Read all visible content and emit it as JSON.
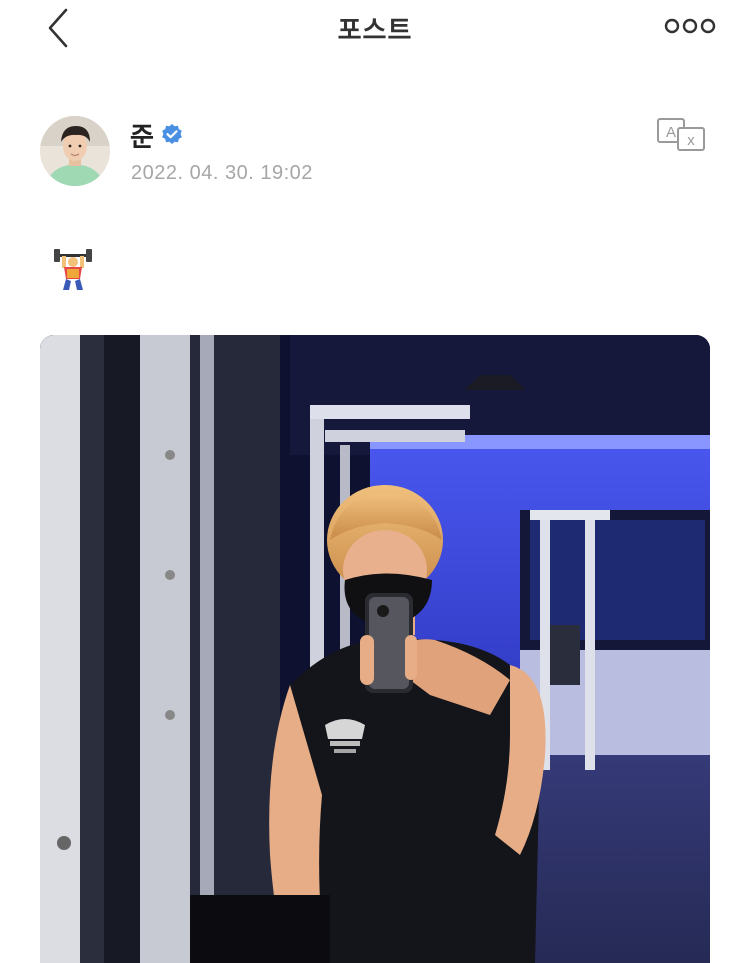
{
  "header": {
    "title": "포스트",
    "back_icon": "chevron-left-icon",
    "more_icon": "more-dots-icon"
  },
  "post": {
    "author": {
      "name": "준",
      "verified": true,
      "verified_color": "#4a90e2",
      "avatar_icon": "avatar-photo"
    },
    "timestamp": "2022. 04. 30. 19:02",
    "translate_icon": "translate-icon",
    "body_emoji": "🏋️",
    "media": {
      "type": "photo",
      "description_icon": "gym-mirror-selfie-photo"
    }
  },
  "colors": {
    "accent_blue": "#4a90e2",
    "muted_text": "#a6a6a6",
    "gym_blue": "#2a35d8"
  }
}
